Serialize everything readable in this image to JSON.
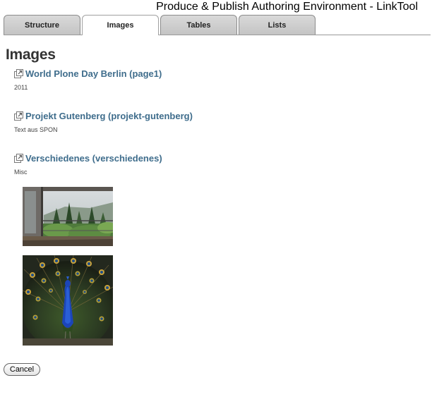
{
  "app": {
    "title": "Produce & Publish Authoring Environment - LinkTool"
  },
  "tabs": [
    {
      "label": "Structure",
      "active": false
    },
    {
      "label": "Images",
      "active": true
    },
    {
      "label": "Tables",
      "active": false
    },
    {
      "label": "Lists",
      "active": false
    }
  ],
  "page": {
    "title": "Images"
  },
  "entries": [
    {
      "title": "World Plone Day Berlin (page1)",
      "description": "2011",
      "icon": "external-link-icon"
    },
    {
      "title": "Projekt Gutenberg (projekt-gutenberg)",
      "description": "Text aus SPON",
      "icon": "external-link-icon"
    },
    {
      "title": "Verschiedenes (verschiedenes)",
      "description": "Misc",
      "icon": "external-link-icon"
    }
  ],
  "images": [
    {
      "subject": "balcony view over a green forested valley"
    },
    {
      "subject": "peacock with fanned tail feathers"
    }
  ],
  "actions": {
    "cancel_label": "Cancel"
  },
  "colors": {
    "link": "#3f6d8c",
    "tab_bg": "#cfcfcf",
    "tab_active_bg": "#ffffff"
  }
}
